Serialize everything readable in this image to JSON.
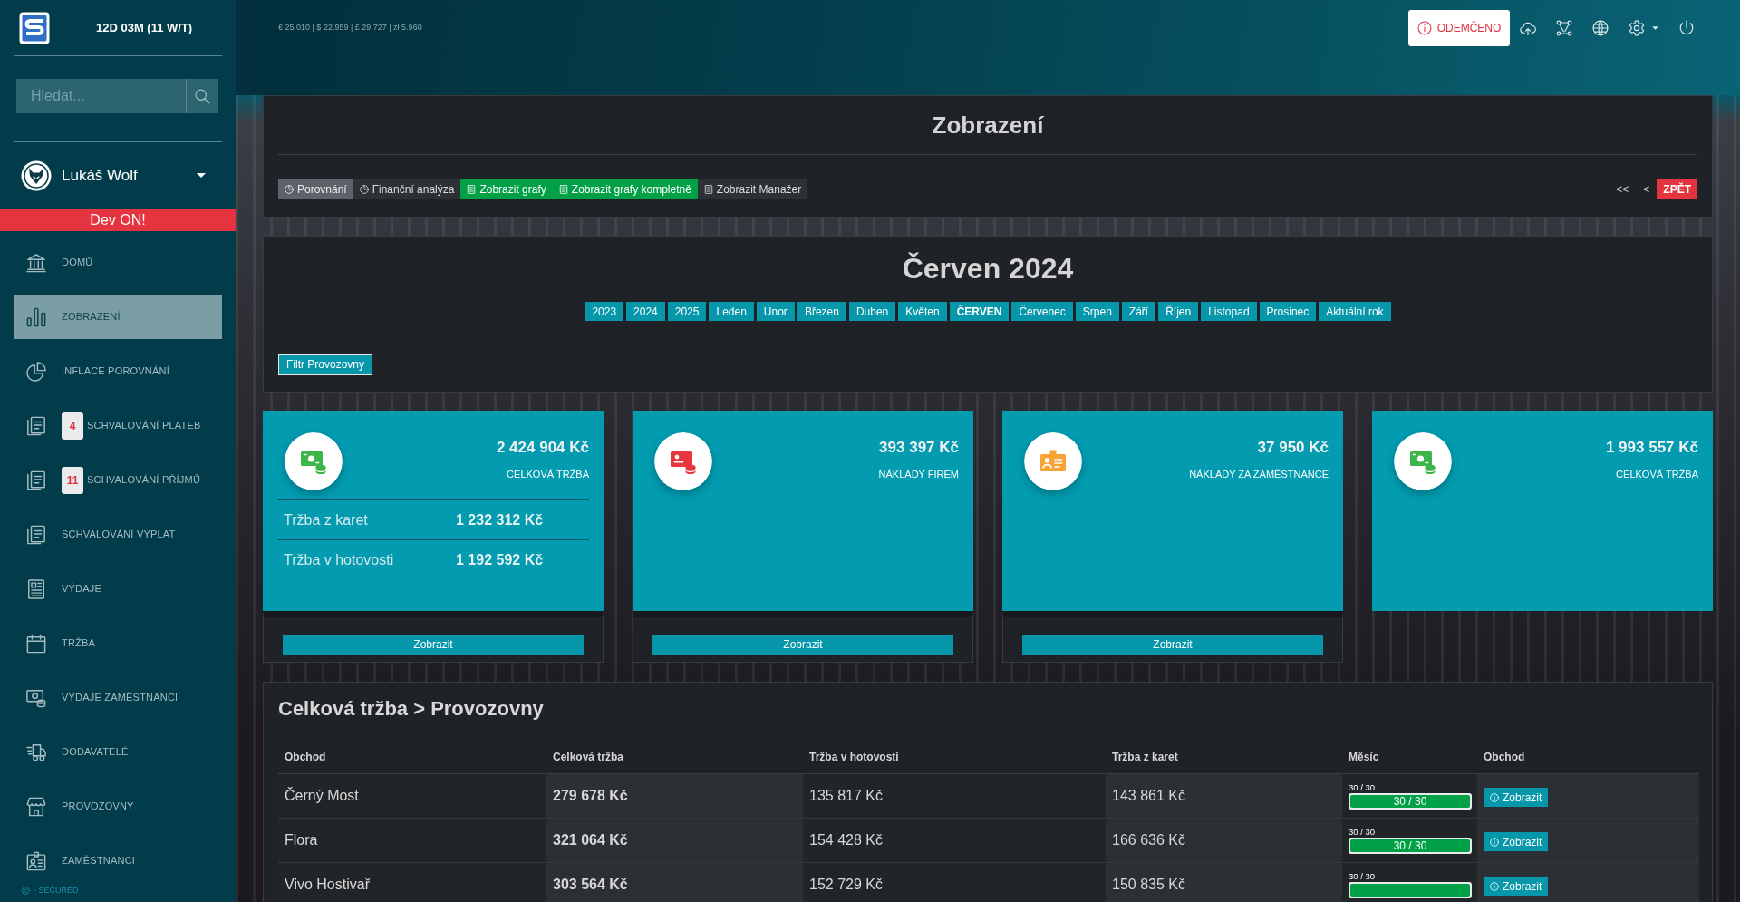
{
  "sidebar": {
    "uptime": "12D 03M (11 W/T)",
    "search": {
      "placeholder": "Hledat..."
    },
    "user": {
      "name": "Lukáš Wolf"
    },
    "dev_banner": "Dev ON!",
    "items": [
      {
        "label": "DOMŮ",
        "selected": false
      },
      {
        "label": "ZOBRAZENÍ",
        "selected": true
      },
      {
        "label": "INFLACE POROVNÁNÍ",
        "selected": false
      },
      {
        "label": "SCHVALOVÁNÍ PLATEB",
        "badge": "4",
        "selected": false
      },
      {
        "label": "SCHVALOVÁNÍ PŘÍJMŮ",
        "badge": "11",
        "selected": false
      },
      {
        "label": "SCHVALOVÁNÍ VÝPLAT",
        "selected": false
      },
      {
        "label": "VÝDAJE",
        "selected": false
      },
      {
        "label": "TRŽBA",
        "selected": false
      },
      {
        "label": "VÝDAJE ZAMĚSTNANCI",
        "selected": false
      },
      {
        "label": "DODAVATELÉ",
        "selected": false
      },
      {
        "label": "PROVOZOVNY",
        "selected": false
      },
      {
        "label": "ZAMĚSTNANCI",
        "selected": false
      }
    ],
    "footer": "- SECURED"
  },
  "top_bar": {
    "rates": "€ 25.010 | $ 22.959 | £ 29.727 | zł 5.960",
    "lock_button": "ODEMČENO"
  },
  "view_panel": {
    "title": "Zobrazení",
    "buttons": [
      {
        "label": "Porovnání",
        "kind": "secondary"
      },
      {
        "label": "Finanční analýza",
        "kind": "dark"
      },
      {
        "label": "Zobrazit grafy",
        "kind": "success"
      },
      {
        "label": "Zobrazit grafy kompletně",
        "kind": "success"
      },
      {
        "label": "Zobrazit Manažer",
        "kind": "dark"
      }
    ],
    "nav": [
      {
        "label": "<<",
        "kind": "link"
      },
      {
        "label": "<",
        "kind": "link"
      },
      {
        "label": "ZPĚT",
        "kind": "danger"
      }
    ]
  },
  "period_panel": {
    "title": "Červen 2024",
    "periods": [
      {
        "label": "2023",
        "selected": false
      },
      {
        "label": "2024",
        "selected": false
      },
      {
        "label": "2025",
        "selected": false
      },
      {
        "label": "Leden",
        "selected": false
      },
      {
        "label": "Únor",
        "selected": false
      },
      {
        "label": "Březen",
        "selected": false
      },
      {
        "label": "Duben",
        "selected": false
      },
      {
        "label": "Květen",
        "selected": false
      },
      {
        "label": "ČERVEN",
        "selected": true
      },
      {
        "label": "Červenec",
        "selected": false
      },
      {
        "label": "Srpen",
        "selected": false
      },
      {
        "label": "Září",
        "selected": false
      },
      {
        "label": "Říjen",
        "selected": false
      },
      {
        "label": "Listopad",
        "selected": false
      },
      {
        "label": "Prosinec",
        "selected": false
      },
      {
        "label": "Aktuální rok",
        "selected": false
      }
    ],
    "filter_button": "Filtr Provozovny"
  },
  "cards": [
    {
      "color": "#3cb54a",
      "amount": "2 424 904 Kč",
      "label": "CELKOVÁ TRŽBA",
      "rows": [
        {
          "label": "Tržba z karet",
          "value": "1 232 312 Kč"
        },
        {
          "label": "Tržba v hotovosti",
          "value": "1 192 592 Kč"
        }
      ],
      "button": "Zobrazit"
    },
    {
      "color": "#e9353f",
      "amount": "393 397 Kč",
      "label": "NÁKLADY FIREM",
      "button": "Zobrazit"
    },
    {
      "color": "#f7a336",
      "amount": "37 950 Kč",
      "label": "NÁKLADY ZA ZAMĚSTNANCE",
      "button": "Zobrazit"
    },
    {
      "color": "#3cb54a",
      "amount": "1 993 557 Kč",
      "label": "CELKOVÁ TRŽBA"
    }
  ],
  "table": {
    "title": "Celková tržba > Provozovny",
    "columns": [
      "Obchod",
      "Celková tržba",
      "Tržba v hotovosti",
      "Tržba z karet",
      "Měsíc",
      "Obchod"
    ],
    "rows": [
      {
        "shop": "Černý Most",
        "total": "279 678 Kč",
        "cash": "135 817 Kč",
        "card": "143 861 Kč",
        "month": {
          "caption": "30 / 30",
          "level": 1,
          "bar_label": "30 / 30"
        },
        "action": "Zobrazit"
      },
      {
        "shop": "Flora",
        "total": "321 064 Kč",
        "cash": "154 428 Kč",
        "card": "166 636 Kč",
        "month": {
          "caption": "30 / 30",
          "level": 1,
          "bar_label": "30 / 30"
        },
        "action": "Zobrazit"
      },
      {
        "shop": "Vivo Hostivař",
        "total": "303 564 Kč",
        "cash": "152 729 Kč",
        "card": "150 835 Kč",
        "month": {
          "caption": "30 / 30",
          "level": 1
        },
        "action": "Zobrazit"
      }
    ]
  }
}
